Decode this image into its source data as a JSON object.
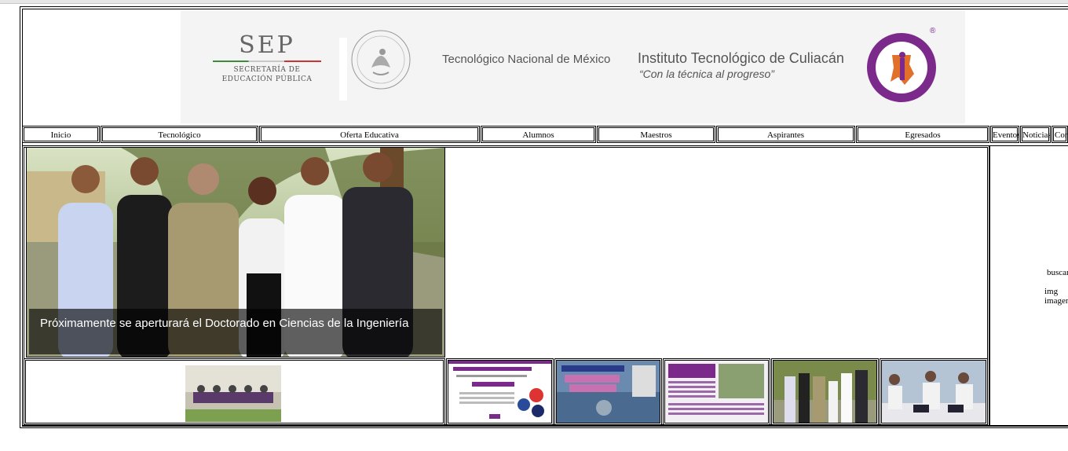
{
  "header": {
    "sep_title": "SEP",
    "sep_sub1": "SECRETARÍA DE",
    "sep_sub2": "EDUCACIÓN PÚBLICA",
    "tecnm": "Tecnológico Nacional de México",
    "institute": "Instituto Tecnológico de Culiacán",
    "motto": "“Con la técnica al progreso”",
    "logo_mark": "®"
  },
  "nav": {
    "items": [
      "Inicio",
      "Tecnológico",
      "Oferta Educativa",
      "Alumnos",
      "Maestros",
      "Aspirantes",
      "Egresados",
      "Eventos",
      "Noticias",
      "Cont"
    ]
  },
  "hero": {
    "caption": "Próximamente se aperturará el Doctorado en Ciencias de la Ingeniería"
  },
  "sidebar": {
    "text1": "buscar",
    "text2": "img imagen"
  },
  "colors": {
    "purple": "#7b2a8c",
    "orange": "#e0702a",
    "banner_bg": "#f4f4f4"
  }
}
